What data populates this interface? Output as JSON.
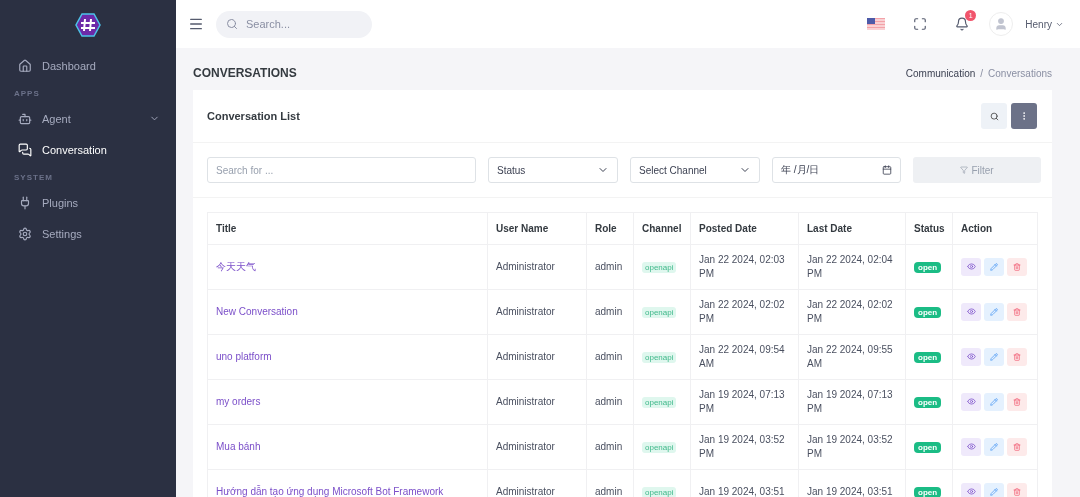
{
  "sidebar": {
    "items": [
      {
        "kind": "item",
        "label": "Dashboard",
        "selected": false
      },
      {
        "kind": "section",
        "label": "APPS"
      },
      {
        "kind": "item",
        "label": "Agent",
        "selected": false,
        "expandable": true
      },
      {
        "kind": "item",
        "label": "Conversation",
        "selected": true
      },
      {
        "kind": "section",
        "label": "SYSTEM"
      },
      {
        "kind": "item",
        "label": "Plugins",
        "selected": false
      },
      {
        "kind": "item",
        "label": "Settings",
        "selected": false
      }
    ]
  },
  "topbar": {
    "search": {
      "placeholder": "Search..."
    },
    "notifications": "1",
    "user": "Henry"
  },
  "page": {
    "title": "CONVERSATIONS",
    "breadcrumb_separator": "/",
    "breadcrumb": [
      {
        "label": "Communication",
        "selected": false
      },
      {
        "label": "Conversations",
        "selected": true
      }
    ]
  },
  "card": {
    "title": "Conversation List",
    "filters": {
      "search": {
        "placeholder": "Search for ..."
      },
      "status": "Status",
      "channel": "Select Channel",
      "date": "年 /月/日",
      "button": "Filter"
    },
    "table": {
      "columns": [
        "Title",
        "User Name",
        "Role",
        "Channel",
        "Posted Date",
        "Last Date",
        "Status",
        "Action"
      ],
      "rows": [
        {
          "title": "今天天气",
          "user": "Administrator",
          "role": "admin",
          "channel": "openapi",
          "posted": [
            "Jan 22 2024, 02:03",
            "PM"
          ],
          "last": [
            "Jan 22 2024, 02:04",
            "PM"
          ],
          "status": "open"
        },
        {
          "title": "New Conversation",
          "user": "Administrator",
          "role": "admin",
          "channel": "openapi",
          "posted": [
            "Jan 22 2024, 02:02",
            "PM"
          ],
          "last": [
            "Jan 22 2024, 02:02",
            "PM"
          ],
          "status": "open"
        },
        {
          "title": "uno platform",
          "user": "Administrator",
          "role": "admin",
          "channel": "openapi",
          "posted": [
            "Jan 22 2024, 09:54",
            "AM"
          ],
          "last": [
            "Jan 22 2024, 09:55",
            "AM"
          ],
          "status": "open"
        },
        {
          "title": "my orders",
          "user": "Administrator",
          "role": "admin",
          "channel": "openapi",
          "posted": [
            "Jan 19 2024, 07:13",
            "PM"
          ],
          "last": [
            "Jan 19 2024, 07:13",
            "PM"
          ],
          "status": "open"
        },
        {
          "title": "Mua bánh",
          "user": "Administrator",
          "role": "admin",
          "channel": "openapi",
          "posted": [
            "Jan 19 2024, 03:52",
            "PM"
          ],
          "last": [
            "Jan 19 2024, 03:52",
            "PM"
          ],
          "status": "open"
        },
        {
          "title": "Hướng dẫn tạo ứng dụng Microsoft Bot Framework",
          "user": "Administrator",
          "role": "admin",
          "channel": "openapi",
          "posted": [
            "Jan 19 2024, 03:51"
          ],
          "last": [
            "Jan 19 2024, 03:51"
          ],
          "status": "open"
        }
      ]
    }
  }
}
